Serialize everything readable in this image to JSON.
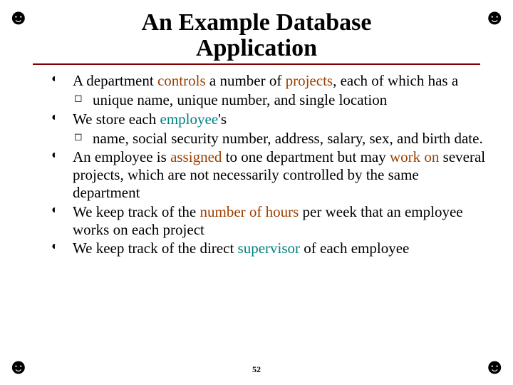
{
  "decor": {
    "corner_glyph": "☻"
  },
  "title": {
    "line1": "An Example Database",
    "line2": "Application"
  },
  "page_number": "52",
  "bullets": {
    "b1": {
      "p1": "A department ",
      "hl1": "controls",
      "p2": " a number of ",
      "hl2": "projects",
      "p3": ", each of which has a",
      "sub": "unique name, unique number, and single location"
    },
    "b2": {
      "p1": "We store each ",
      "hl1": "employee",
      "p2": "'s",
      "sub": "name, social security number, address, salary, sex, and birth date."
    },
    "b3": {
      "p1": "An employee is ",
      "hl1": "assigned",
      "p2": " to one department but may ",
      "hl2": "work on",
      "p3": " several projects, which are not necessarily controlled by the same department"
    },
    "b4": {
      "p1": "We keep track of the ",
      "hl1": "number of hours",
      "p2": " per week that an employee works on each project"
    },
    "b5": {
      "p1": "We keep track of the direct ",
      "hl1": "supervisor",
      "p2": " of each employee"
    }
  }
}
